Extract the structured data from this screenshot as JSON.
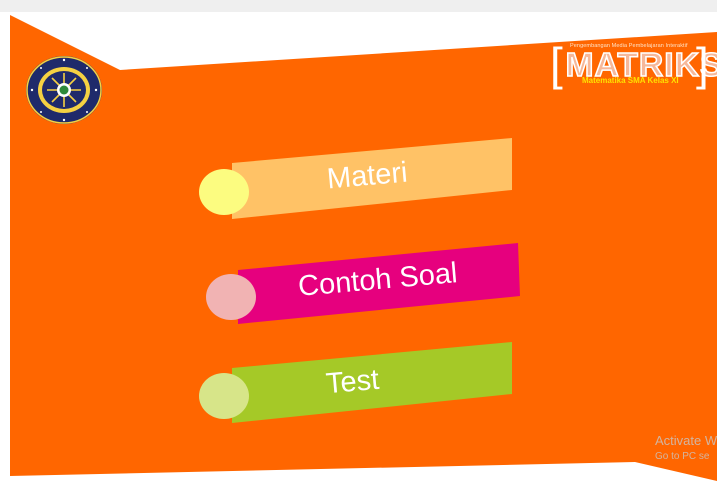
{
  "window": {
    "title": ""
  },
  "logo": {
    "alt": "Universitas Muhammadiyah Sumatera Utara"
  },
  "brand": {
    "tagline": "Pengembangan Media Pembelajaran Interaktif",
    "title": "MATRIKS",
    "subtitle": "Matematika SMA Kelas XI"
  },
  "menu": {
    "items": [
      {
        "label": "Materi",
        "color": "#ffc266",
        "dot_color": "#fcfc80"
      },
      {
        "label": "Contoh Soal",
        "color": "#e6007e",
        "dot_color": "#f1b3b3"
      },
      {
        "label": "Test",
        "color": "#a5c927",
        "dot_color": "#d7e589"
      }
    ]
  },
  "watermark": {
    "line1": "Activate W",
    "line2": "Go to PC se"
  },
  "colors": {
    "background": "#ff6600",
    "accent": "#ffffff"
  }
}
